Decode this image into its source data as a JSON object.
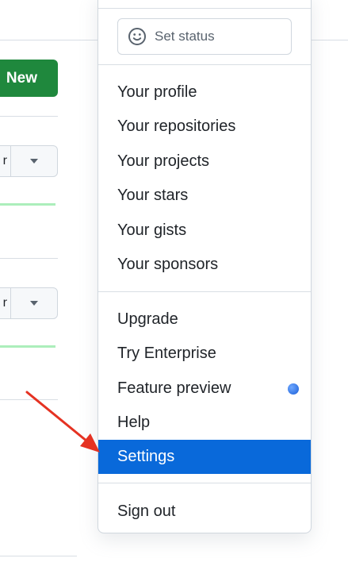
{
  "background_page": {
    "new_button_label": "New",
    "segment_buttons": [
      {
        "text_fragment": "r"
      },
      {
        "text_fragment": "r"
      }
    ]
  },
  "user_menu": {
    "status": {
      "icon": "smiley-icon",
      "label": "Set status"
    },
    "items_group_1": [
      {
        "label": "Your profile"
      },
      {
        "label": "Your repositories"
      },
      {
        "label": "Your projects"
      },
      {
        "label": "Your stars"
      },
      {
        "label": "Your gists"
      },
      {
        "label": "Your sponsors"
      }
    ],
    "items_group_2": [
      {
        "label": "Upgrade"
      },
      {
        "label": "Try Enterprise"
      },
      {
        "label": "Feature preview"
      },
      {
        "label": "Help"
      },
      {
        "label": "Settings",
        "active": true
      }
    ],
    "sign_out_label": "Sign out"
  },
  "colors": {
    "primary_green": "#1f883d",
    "active_blue": "#0969da",
    "annotation_arrow": "#e53222"
  }
}
